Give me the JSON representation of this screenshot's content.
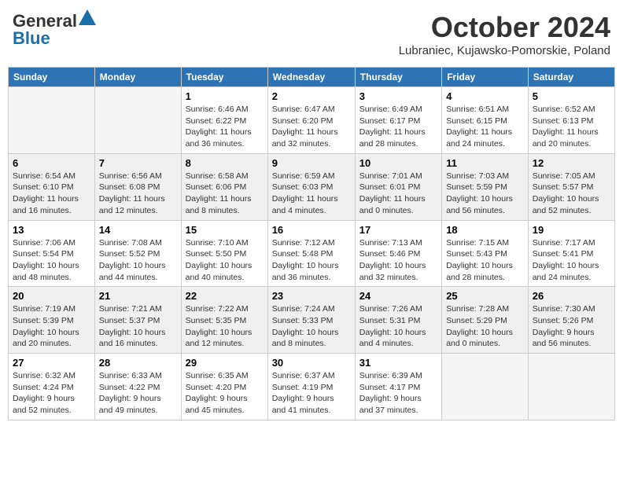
{
  "header": {
    "logo_general": "General",
    "logo_blue": "Blue",
    "month_title": "October 2024",
    "subtitle": "Lubraniec, Kujawsko-Pomorskie, Poland"
  },
  "days_of_week": [
    "Sunday",
    "Monday",
    "Tuesday",
    "Wednesday",
    "Thursday",
    "Friday",
    "Saturday"
  ],
  "weeks": [
    {
      "shade": false,
      "days": [
        {
          "num": "",
          "info": ""
        },
        {
          "num": "",
          "info": ""
        },
        {
          "num": "1",
          "info": "Sunrise: 6:46 AM\nSunset: 6:22 PM\nDaylight: 11 hours\nand 36 minutes."
        },
        {
          "num": "2",
          "info": "Sunrise: 6:47 AM\nSunset: 6:20 PM\nDaylight: 11 hours\nand 32 minutes."
        },
        {
          "num": "3",
          "info": "Sunrise: 6:49 AM\nSunset: 6:17 PM\nDaylight: 11 hours\nand 28 minutes."
        },
        {
          "num": "4",
          "info": "Sunrise: 6:51 AM\nSunset: 6:15 PM\nDaylight: 11 hours\nand 24 minutes."
        },
        {
          "num": "5",
          "info": "Sunrise: 6:52 AM\nSunset: 6:13 PM\nDaylight: 11 hours\nand 20 minutes."
        }
      ]
    },
    {
      "shade": true,
      "days": [
        {
          "num": "6",
          "info": "Sunrise: 6:54 AM\nSunset: 6:10 PM\nDaylight: 11 hours\nand 16 minutes."
        },
        {
          "num": "7",
          "info": "Sunrise: 6:56 AM\nSunset: 6:08 PM\nDaylight: 11 hours\nand 12 minutes."
        },
        {
          "num": "8",
          "info": "Sunrise: 6:58 AM\nSunset: 6:06 PM\nDaylight: 11 hours\nand 8 minutes."
        },
        {
          "num": "9",
          "info": "Sunrise: 6:59 AM\nSunset: 6:03 PM\nDaylight: 11 hours\nand 4 minutes."
        },
        {
          "num": "10",
          "info": "Sunrise: 7:01 AM\nSunset: 6:01 PM\nDaylight: 11 hours\nand 0 minutes."
        },
        {
          "num": "11",
          "info": "Sunrise: 7:03 AM\nSunset: 5:59 PM\nDaylight: 10 hours\nand 56 minutes."
        },
        {
          "num": "12",
          "info": "Sunrise: 7:05 AM\nSunset: 5:57 PM\nDaylight: 10 hours\nand 52 minutes."
        }
      ]
    },
    {
      "shade": false,
      "days": [
        {
          "num": "13",
          "info": "Sunrise: 7:06 AM\nSunset: 5:54 PM\nDaylight: 10 hours\nand 48 minutes."
        },
        {
          "num": "14",
          "info": "Sunrise: 7:08 AM\nSunset: 5:52 PM\nDaylight: 10 hours\nand 44 minutes."
        },
        {
          "num": "15",
          "info": "Sunrise: 7:10 AM\nSunset: 5:50 PM\nDaylight: 10 hours\nand 40 minutes."
        },
        {
          "num": "16",
          "info": "Sunrise: 7:12 AM\nSunset: 5:48 PM\nDaylight: 10 hours\nand 36 minutes."
        },
        {
          "num": "17",
          "info": "Sunrise: 7:13 AM\nSunset: 5:46 PM\nDaylight: 10 hours\nand 32 minutes."
        },
        {
          "num": "18",
          "info": "Sunrise: 7:15 AM\nSunset: 5:43 PM\nDaylight: 10 hours\nand 28 minutes."
        },
        {
          "num": "19",
          "info": "Sunrise: 7:17 AM\nSunset: 5:41 PM\nDaylight: 10 hours\nand 24 minutes."
        }
      ]
    },
    {
      "shade": true,
      "days": [
        {
          "num": "20",
          "info": "Sunrise: 7:19 AM\nSunset: 5:39 PM\nDaylight: 10 hours\nand 20 minutes."
        },
        {
          "num": "21",
          "info": "Sunrise: 7:21 AM\nSunset: 5:37 PM\nDaylight: 10 hours\nand 16 minutes."
        },
        {
          "num": "22",
          "info": "Sunrise: 7:22 AM\nSunset: 5:35 PM\nDaylight: 10 hours\nand 12 minutes."
        },
        {
          "num": "23",
          "info": "Sunrise: 7:24 AM\nSunset: 5:33 PM\nDaylight: 10 hours\nand 8 minutes."
        },
        {
          "num": "24",
          "info": "Sunrise: 7:26 AM\nSunset: 5:31 PM\nDaylight: 10 hours\nand 4 minutes."
        },
        {
          "num": "25",
          "info": "Sunrise: 7:28 AM\nSunset: 5:29 PM\nDaylight: 10 hours\nand 0 minutes."
        },
        {
          "num": "26",
          "info": "Sunrise: 7:30 AM\nSunset: 5:26 PM\nDaylight: 9 hours\nand 56 minutes."
        }
      ]
    },
    {
      "shade": false,
      "days": [
        {
          "num": "27",
          "info": "Sunrise: 6:32 AM\nSunset: 4:24 PM\nDaylight: 9 hours\nand 52 minutes."
        },
        {
          "num": "28",
          "info": "Sunrise: 6:33 AM\nSunset: 4:22 PM\nDaylight: 9 hours\nand 49 minutes."
        },
        {
          "num": "29",
          "info": "Sunrise: 6:35 AM\nSunset: 4:20 PM\nDaylight: 9 hours\nand 45 minutes."
        },
        {
          "num": "30",
          "info": "Sunrise: 6:37 AM\nSunset: 4:19 PM\nDaylight: 9 hours\nand 41 minutes."
        },
        {
          "num": "31",
          "info": "Sunrise: 6:39 AM\nSunset: 4:17 PM\nDaylight: 9 hours\nand 37 minutes."
        },
        {
          "num": "",
          "info": ""
        },
        {
          "num": "",
          "info": ""
        }
      ]
    }
  ]
}
